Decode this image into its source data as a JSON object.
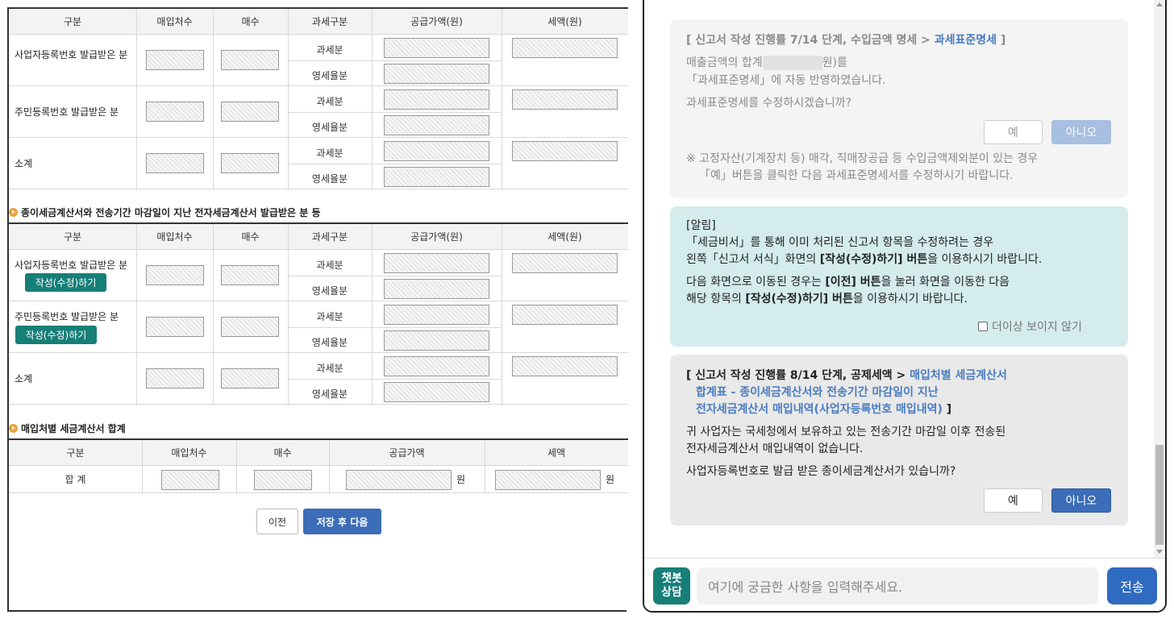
{
  "form": {
    "table1": {
      "headers": [
        "구분",
        "매입처수",
        "매수",
        "과세구분",
        "공급가액(원)",
        "세액(원)"
      ],
      "rows": [
        {
          "label": "사업자등록번호 발급받은 분",
          "type1": "과세분",
          "type2": "영세율분"
        },
        {
          "label": "주민등록번호 발급받은 분",
          "type1": "과세분",
          "type2": "영세율분"
        },
        {
          "label": "소계",
          "type1": "과세분",
          "type2": "영세율분"
        }
      ]
    },
    "section2_title": "종이세금계산서와 전송기간 마감일이 지난 전자세금계산서 발급받은 분 등",
    "table2": {
      "headers": [
        "구분",
        "매입처수",
        "매수",
        "과세구분",
        "공급가액(원)",
        "세액(원)"
      ],
      "rows": [
        {
          "label": "사업자등록번호 발급받은 분",
          "type1": "과세분",
          "type2": "영세율분",
          "button": "작성(수정)하기"
        },
        {
          "label": "주민등록번호 발급받은 분",
          "type1": "과세분",
          "type2": "영세율분",
          "button": "작성(수정)하기"
        },
        {
          "label": "소계",
          "type1": "과세분",
          "type2": "영세율분"
        }
      ]
    },
    "section3_title": "매입처별 세금계산서 합계",
    "table3": {
      "headers": [
        "구분",
        "매입처수",
        "매수",
        "공급가액",
        "세액"
      ],
      "total_label": "합 계",
      "unit": "원"
    },
    "prev_button": "이전",
    "save_next_button": "저장 후 다음"
  },
  "chat": {
    "card1": {
      "header_prefix": "[ 신고서 작성 진행률 7/14 단계, 수입금액 명세 > ",
      "header_link": "과세표준명세",
      "header_suffix": " ]",
      "line1a": "매출금액의 합계",
      "line1b": "원)를",
      "line2": "「과세표준명세」에 자동 반영하였습니다.",
      "question": "과세표준명세를 수정하시겠습니까?",
      "yes": "예",
      "no": "아니오",
      "note1": "※ 고정자산(기계장치 등) 매각, 직매장공급 등 수입금액제외분이 있는 경우",
      "note2": "「예」버튼을 클릭한 다음 과세표준명세서를 수정하시기 바랍니다."
    },
    "card2": {
      "title": "[알림]",
      "line1": "「세금비서」를 통해 이미 처리된 신고서 항목을 수정하려는 경우",
      "line2a": "왼쪽「신고서 서식」화면의 ",
      "line2b": "[작성(수정)하기] 버튼",
      "line2c": "을 이용하시기 바랍니다.",
      "line3a": "다음 화면으로 이동된 경우는 ",
      "line3b": "[이전] 버튼",
      "line3c": "을 눌러 화면을 이동한 다음",
      "line4a": "해당 항목의 ",
      "line4b": "[작성(수정)하기] 버튼",
      "line4c": "을 이용하시기 바랍니다.",
      "dont_show": "더이상 보이지 않기"
    },
    "card3": {
      "header_prefix": "[ 신고서 작성 진행률 8/14 단계, 공제세액 > ",
      "header_link1": "매입처별 세금계산서",
      "header_link2": "합계표 - 종이세금계산서와 전송기간 마감일이 지난",
      "header_link3": "전자세금계산서 매입내역(사업자등록번호 매입내역)",
      "header_suffix": " ]",
      "body1": "귀 사업자는 국세청에서 보유하고 있는 전송기간 마감일 이후 전송된",
      "body2": "전자세금계산서 매입내역이 없습니다.",
      "question": "사업자등록번호로 발급 받은 종이세금계산서가 있습니까?",
      "yes": "예",
      "no": "아니오"
    },
    "input_placeholder": "여기에 궁금한 사항을 입력해주세요.",
    "bot_badge": "챗봇\n상담",
    "send": "전송"
  }
}
